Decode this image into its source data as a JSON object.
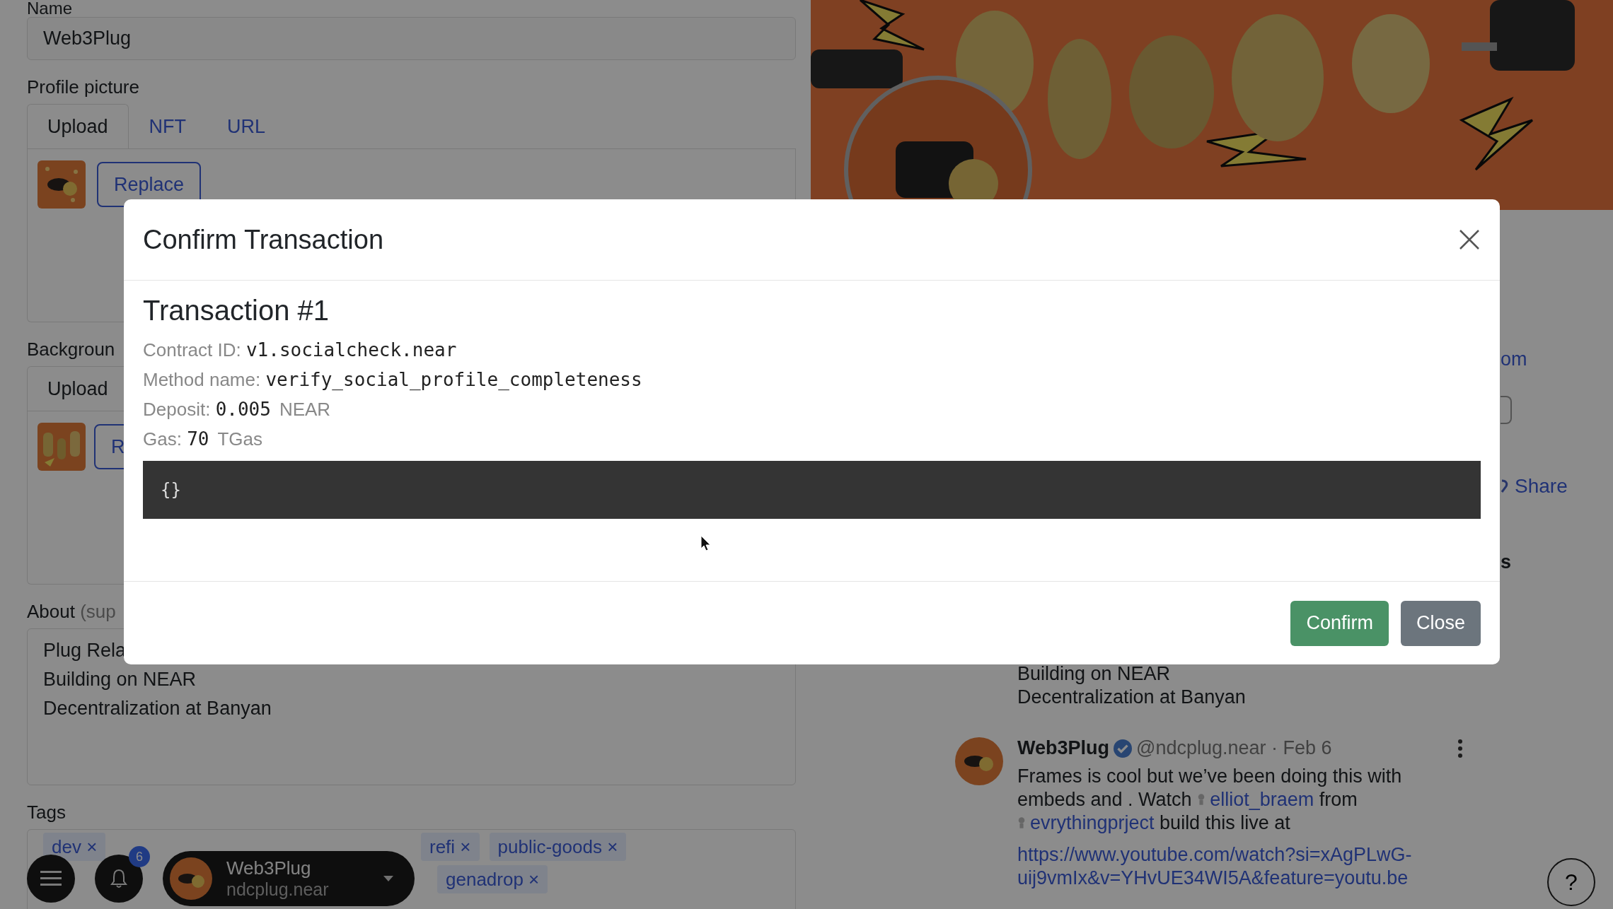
{
  "profile_form": {
    "name": {
      "label": "Name",
      "value": "Web3Plug"
    },
    "profile_picture": {
      "label": "Profile picture",
      "tabs": [
        {
          "label": "Upload",
          "selected": true
        },
        {
          "label": "NFT",
          "selected": false
        },
        {
          "label": "URL",
          "selected": false
        }
      ],
      "button": "Replace"
    },
    "background": {
      "label": "Backgroun",
      "tabs": [
        {
          "label": "Upload",
          "selected": true
        }
      ],
      "button": "R"
    },
    "about": {
      "label": "About",
      "hint": "(sup",
      "lines": [
        "Plug Rela",
        "Building on NEAR",
        "Decentralization at Banyan"
      ]
    },
    "tags": {
      "label": "Tags",
      "items": [
        {
          "label": "dev",
          "remove": "×"
        },
        {
          "label": "refi",
          "remove": "×"
        },
        {
          "label": "public-goods",
          "remove": "×"
        },
        {
          "label": "genadrop",
          "remove": "×"
        }
      ]
    }
  },
  "profile_preview": {
    "link_fragment": "om",
    "share": "Share",
    "text_fragment": "s",
    "about_lines": [
      "Building on NEAR",
      "Decentralization at Banyan"
    ],
    "post": {
      "author": "Web3Plug",
      "verified": true,
      "meta": "@ndcplug.near · Feb 6",
      "text": [
        {
          "kind": "text",
          "text": "Frames is cool but we’ve been doing this with embeds and . Watch "
        },
        {
          "kind": "mention",
          "text": "elliot_braem"
        },
        {
          "kind": "text",
          "text": " from "
        },
        {
          "kind": "mention",
          "text": "evrythingprject"
        },
        {
          "kind": "text",
          "text": " build this live at"
        }
      ],
      "link": "https://www.youtube.com/watch?si=xAgPLwG-uij9vmIx&v=YHvUE34WI5A&feature=youtu.be"
    }
  },
  "bottom_bar": {
    "notification_count": "6",
    "user": {
      "name": "Web3Plug",
      "account": "ndcplug.near"
    }
  },
  "help_button": "?",
  "modal": {
    "title": "Confirm Transaction",
    "transaction_title": "Transaction #1",
    "details": [
      {
        "label": "Contract ID:",
        "value": "v1.socialcheck.near"
      },
      {
        "label": "Method name:",
        "value": "verify_social_profile_completeness"
      },
      {
        "label": "Deposit:",
        "value": "0.005",
        "unit": "NEAR"
      },
      {
        "label": "Gas:",
        "value": "70",
        "unit": "TGas"
      }
    ],
    "args": "{}",
    "buttons": [
      {
        "label": "Confirm",
        "kind": "primary"
      },
      {
        "label": "Close",
        "kind": "secondary"
      }
    ]
  }
}
